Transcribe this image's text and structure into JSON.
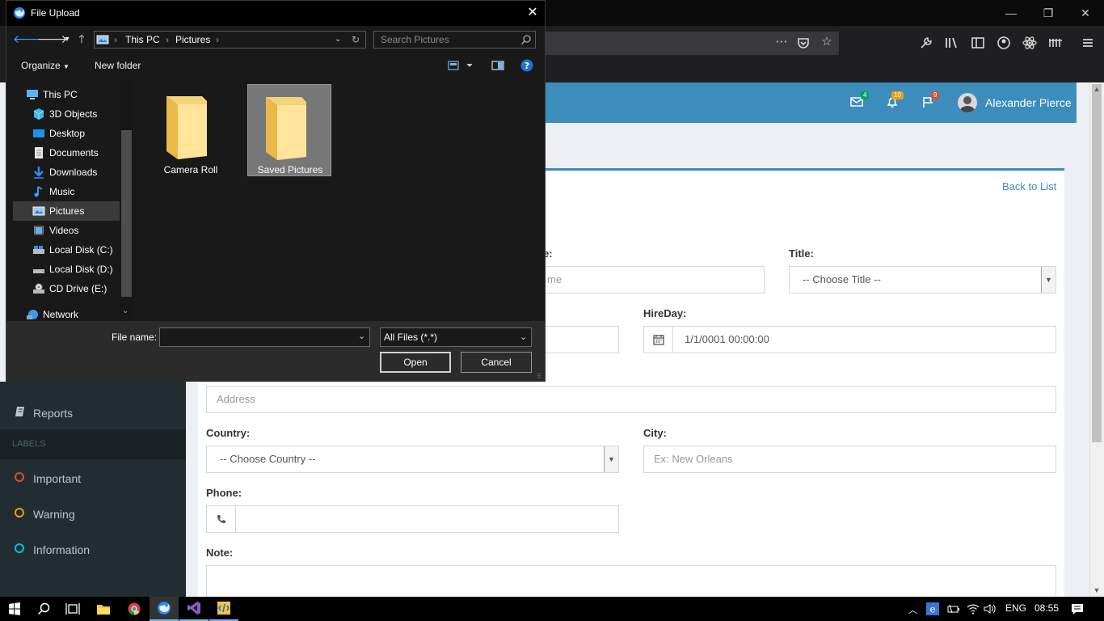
{
  "browser": {
    "window_controls": {
      "minimize": "—",
      "restore": "❐",
      "close": "✕"
    },
    "toolbar_icons": [
      "wrench-icon",
      "library-icon",
      "sidebar-icon",
      "account-icon",
      "react-icon",
      "extensions-icon",
      "menu-icon"
    ]
  },
  "page": {
    "header": {
      "user_name": "Alexander Pierce",
      "mail_count": "4",
      "notification_count": "10",
      "flag_count": "9"
    },
    "sidebar": {
      "reports": "Reports",
      "labels_header": "LABELS",
      "labels": [
        {
          "label": "Important",
          "color": "#dd4b39"
        },
        {
          "label": "Warning",
          "color": "#f39c12"
        },
        {
          "label": "Information",
          "color": "#00c0ef"
        }
      ]
    },
    "form": {
      "back_link": "Back to List",
      "name_label_partial": "e:",
      "name_placeholder_partial": "me",
      "title_label": "Title:",
      "title_value": "-- Choose Title --",
      "hireday_label": "HireDay:",
      "hireday_value": "1/1/0001 00:00:00",
      "address_placeholder": "Address",
      "country_label": "Country:",
      "country_value": "-- Choose Country --",
      "city_label": "City:",
      "city_placeholder": "Ex: New Orleans",
      "phone_label": "Phone:",
      "note_label": "Note:"
    }
  },
  "dialog": {
    "title": "File Upload",
    "path": [
      "This PC",
      "Pictures"
    ],
    "search_placeholder": "Search Pictures",
    "organize": "Organize",
    "new_folder": "New folder",
    "tree": [
      {
        "label": "This PC",
        "icon": "pc-icon"
      },
      {
        "label": "3D Objects",
        "icon": "3d-objects-icon"
      },
      {
        "label": "Desktop",
        "icon": "desktop-icon"
      },
      {
        "label": "Documents",
        "icon": "documents-icon"
      },
      {
        "label": "Downloads",
        "icon": "downloads-icon"
      },
      {
        "label": "Music",
        "icon": "music-icon"
      },
      {
        "label": "Pictures",
        "icon": "pictures-icon"
      },
      {
        "label": "Videos",
        "icon": "videos-icon"
      },
      {
        "label": "Local Disk (C:)",
        "icon": "disk-icon"
      },
      {
        "label": "Local Disk (D:)",
        "icon": "disk-icon"
      },
      {
        "label": "CD Drive (E:)",
        "icon": "cd-drive-icon"
      },
      {
        "label": "Network",
        "icon": "network-icon"
      }
    ],
    "files": [
      {
        "name": "Camera Roll",
        "selected": false
      },
      {
        "name": "Saved Pictures",
        "selected": true
      }
    ],
    "file_name_label": "File name:",
    "file_type": "All Files (*.*)",
    "open": "Open",
    "cancel": "Cancel"
  },
  "taskbar": {
    "lang": "ENG",
    "time": "08:55"
  }
}
